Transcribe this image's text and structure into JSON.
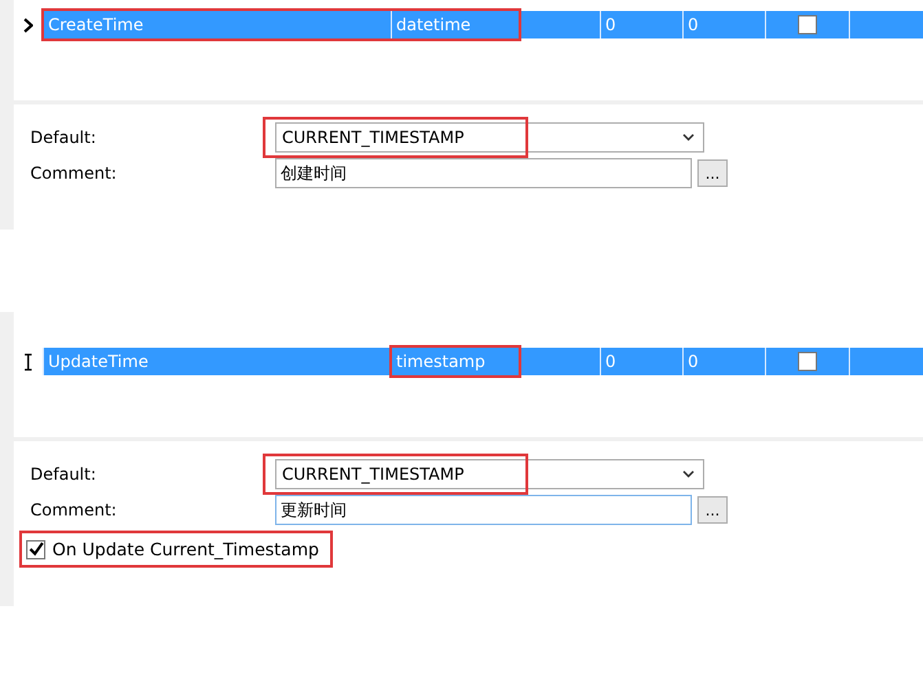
{
  "panels": [
    {
      "row": {
        "kind": "arrow",
        "name": "CreateTime",
        "type": "datetime",
        "column_3": "0",
        "column_4": "0",
        "not_null": false,
        "selected": true,
        "name_highlighted": true,
        "type_highlighted": true
      },
      "default": {
        "label": "Default:",
        "value": "CURRENT_TIMESTAMP",
        "highlighted": true
      },
      "comment": {
        "label": "Comment:",
        "value": "创建时间",
        "button": "...",
        "focused": false
      }
    },
    {
      "row": {
        "kind": "cursor",
        "name": "UpdateTime",
        "type": "timestamp",
        "column_3": "0",
        "column_4": "0",
        "not_null": false,
        "selected": true,
        "name_highlighted": false,
        "type_highlighted": true
      },
      "default": {
        "label": "Default:",
        "value": "CURRENT_TIMESTAMP",
        "highlighted": true
      },
      "comment": {
        "label": "Comment:",
        "value": "更新时间",
        "button": "...",
        "focused": true
      },
      "on_update": {
        "label": "On Update Current_Timestamp",
        "checked": true,
        "highlighted": true
      }
    }
  ]
}
